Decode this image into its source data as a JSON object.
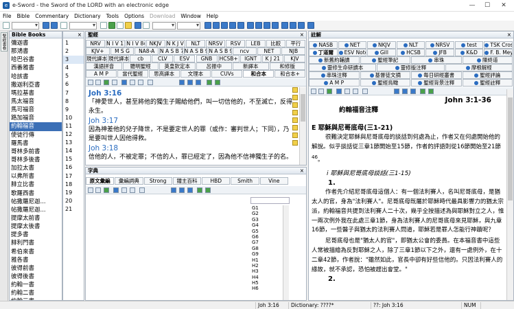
{
  "window": {
    "title": "e-Sword - the Sword of the LORD with an electronic edge",
    "controls": [
      "—",
      "☐",
      "✕"
    ]
  },
  "menu": [
    "File",
    "Bible",
    "Commentary",
    "Dictionary",
    "Tools",
    "Options",
    "Download",
    "Window",
    "Help"
  ],
  "menu_disabled": [
    "Download"
  ],
  "sidebar_tab": "聖經書卷",
  "books_pane": {
    "title": "Bible Books",
    "books": [
      "彌迦書",
      "那鴻書",
      "哈巴谷書",
      "西番雅書",
      "哈該書",
      "撒迦利亞書",
      "瑪拉基書",
      "馬太福音",
      "馬可福音",
      "路加福音",
      "約翰福音",
      "使徒行傳",
      "羅馬書",
      "哥林多前書",
      "哥林多後書",
      "加拉太書",
      "以弗所書",
      "腓立比書",
      "歌羅西書",
      "帖撒羅尼迦...",
      "帖撒羅尼迦...",
      "提摩太前書",
      "提摩太後書",
      "提多書",
      "腓利門書",
      "希伯來書",
      "雅各書",
      "彼得前書",
      "彼得後書",
      "約翰一書",
      "約翰二書",
      "約翰三書",
      "猶大書"
    ],
    "selected_book": "約翰福音"
  },
  "chapters_pane": {
    "chapters": [
      "1",
      "2",
      "3",
      "4",
      "5",
      "6",
      "7",
      "8",
      "9",
      "10",
      "11",
      "12",
      "13",
      "14",
      "15",
      "16",
      "17",
      "18",
      "19",
      "20",
      "21"
    ],
    "selected": "3"
  },
  "bible_pane": {
    "title": "聖經",
    "tabs_row1": [
      "NRV",
      "N I V 11",
      "N I V 84",
      "NKJV",
      "N K J V +",
      "NLT",
      "NRSV",
      "RSV",
      "LEB",
      "比較",
      "平行"
    ],
    "tabs_row2": [
      "KJV+",
      "M S G",
      "NA8-A",
      "N A S B 77",
      "N A S B 95",
      "N A S B 95+",
      "ncv",
      "NET",
      "NJB"
    ],
    "tabs_row3": [
      "現代譯本+",
      "現代譯本",
      "cb",
      "CLV",
      "ESV",
      "GNB",
      "HCSB+",
      "IGNT",
      "K J 21",
      "KJV"
    ],
    "tabs_row4": [
      "漢語拼音",
      "聽明聖經",
      "英皇欽定本",
      "呂振中",
      "新譯本",
      "和修版"
    ],
    "tabs_row5": [
      "A M P",
      "當代聖經",
      "思高譯本",
      "文理本",
      "CUVs",
      "和合本",
      "和合本+"
    ],
    "active_tab": "和合本",
    "verses": [
      {
        "ref": "Joh 3:16",
        "text": "「神愛世人，甚至將他的獨生子賜給他們，叫一切信他的，不至滅亡，反得永生。"
      },
      {
        "ref": "Joh 3:17",
        "text": "因為神差他的兒子降世，不是要定世人的罪（或作：審判世人；下同），乃是要叫世人因他得救。"
      },
      {
        "ref": "Joh 3:18",
        "text": "信他的人，不被定罪；不信的人，罪已經定了，因為他不信神獨生子的名。"
      }
    ]
  },
  "dict_pane": {
    "title": "字典",
    "tabs": [
      "原文彙編",
      "彙編詞典",
      "Strong",
      "鐘主百科",
      "HBD",
      "Smith",
      "Vine"
    ],
    "active_tab": "原文彙編",
    "topics": [
      "G1",
      "G2",
      "G3",
      "G4",
      "G5",
      "G6",
      "G7",
      "G8",
      "G9",
      "H1",
      "H2",
      "H3",
      "H4",
      "H5",
      "H6"
    ]
  },
  "comm_pane": {
    "title": "註解",
    "tabs_row1": [
      "NASB",
      "NET",
      "NKJV",
      "NLT",
      "NRSV",
      "test",
      "TSK Cross References"
    ],
    "tabs_row2": [
      "丁道爾",
      "ESV Notes",
      "Gill",
      "HCSB",
      "JFB",
      "K&D",
      "F. B. Meyer"
    ],
    "tabs_row3": [
      "新舊約輔讀",
      "聖經筆記",
      "串珠",
      "陳終道"
    ],
    "tabs_row4": [
      "靈修生命研讀本",
      "靈修版注釋",
      "摩根解經"
    ],
    "tabs_row5": [
      "串珠注釋",
      "基督徒文摘",
      "每日研經叢書",
      "聖經評論"
    ],
    "tabs_row6": [
      "A M P",
      "聖經鳥瞰",
      "聖經背景注釋",
      "聖經註釋"
    ],
    "active_tab": "丁道爾",
    "heading": "John 3:1-36",
    "subheading": "約翰福音注釋",
    "section": "E 耶穌與尼哥底母(三1-21)",
    "para1": "很難決定耶穌與尼哥底母的談話到何處為止，作者又在何處開始他的解說。似乎談話從三章1節開始至15節，作者的評語則從16節開始至21節",
    "footnote": "46",
    "para1_end": "。",
    "subsection": "i 耶穌與尼哥底母談話(三1-15)",
    "number": "1.",
    "para2": "作者先介紹尼哥底母這個人：有一個法利賽人，名叫尼哥底母，是猶太人的官，身為\"法利賽人\"。尼哥底母既屬於耶穌時代最具影響力的猶太宗派，約翰福音共提到法利賽人二十次，幾乎全按描述為與耶穌對立之人，惟一兩次例外我在此處三章1節，身為法利賽人的尼哥底母來見耶穌，與九章16節，一些醫子與猶太的法利賽人問道，耶穌若是罪人怎能行神蹟呢？",
    "para3": "尼哥底母也是\"猶太人的官\"，即猶太公會的委員。在本福音書中這些人常被描繪為反對耶穌之人，除了三章1節以下之外，還有一處例外，在十二章42節，作者說：\"雖然如此，官長中卻有好些信他的。只因法利賽人的緣故，就不承認，恐怕被趕出會堂。\"",
    "more": "2."
  },
  "status": {
    "verse": "Joh 3:16",
    "dictionary": "Dictionary: ????*",
    "commentary": "??: Joh 3:16",
    "num": "NUM"
  }
}
